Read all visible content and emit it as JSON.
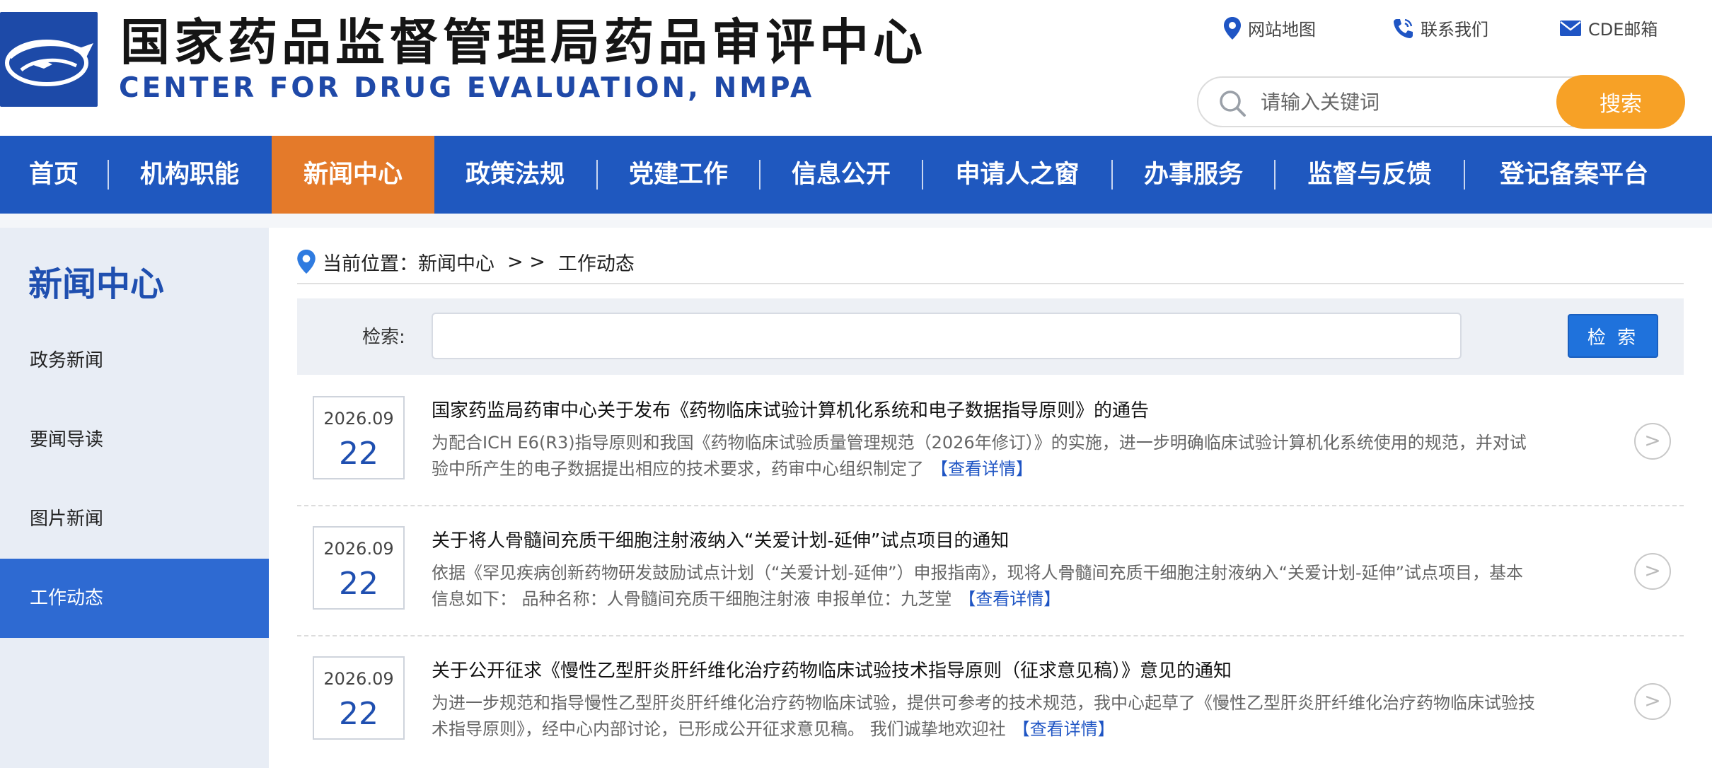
{
  "header": {
    "title_cn": "国家药品监督管理局药品审评中心",
    "title_en": "CENTER FOR DRUG EVALUATION, NMPA",
    "links": [
      {
        "label": "网站地图",
        "icon": "location-pin-icon"
      },
      {
        "label": "联系我们",
        "icon": "phone-icon"
      },
      {
        "label": "CDE邮箱",
        "icon": "mail-icon"
      }
    ],
    "search": {
      "placeholder": "请输入关键词",
      "button": "搜索"
    }
  },
  "nav": {
    "items": [
      {
        "label": "首页"
      },
      {
        "label": "机构职能"
      },
      {
        "label": "新闻中心",
        "active": true
      },
      {
        "label": "政策法规"
      },
      {
        "label": "党建工作"
      },
      {
        "label": "信息公开"
      },
      {
        "label": "申请人之窗"
      },
      {
        "label": "办事服务"
      },
      {
        "label": "监督与反馈"
      },
      {
        "label": "登记备案平台"
      }
    ]
  },
  "sidebar": {
    "title": "新闻中心",
    "items": [
      {
        "label": "政务新闻"
      },
      {
        "label": "要闻导读"
      },
      {
        "label": "图片新闻"
      },
      {
        "label": "工作动态",
        "active": true
      }
    ]
  },
  "breadcrumb": {
    "prefix": "当前位置：",
    "section": "新闻中心",
    "separator": "> >",
    "current": "工作动态"
  },
  "filter": {
    "label": "检索:",
    "value": "",
    "button": "检 索"
  },
  "news": [
    {
      "date_ym": "2026.09",
      "date_d": "22",
      "title": "国家药监局药审中心关于发布《药物临床试验计算机化系统和电子数据指导原则》的通告",
      "desc": "为配合ICH E6(R3)指导原则和我国《药物临床试验质量管理规范（2026年修订）》的实施，进一步明确临床试验计算机化系统使用的规范，并对试验中所产生的电子数据提出相应的技术要求，药审中心组织制定了",
      "more": "【查看详情】"
    },
    {
      "date_ym": "2026.09",
      "date_d": "22",
      "title": "关于将人骨髓间充质干细胞注射液纳入“关爱计划-延伸”试点项目的通知",
      "desc": "依据《罕见疾病创新药物研发鼓励试点计划（“关爱计划-延伸”）申报指南》，现将人骨髓间充质干细胞注射液纳入“关爱计划-延伸”试点项目，基本信息如下：  品种名称：人骨髓间充质干细胞注射液  申报单位：九芝堂",
      "more": "【查看详情】"
    },
    {
      "date_ym": "2026.09",
      "date_d": "22",
      "title": "关于公开征求《慢性乙型肝炎肝纤维化治疗药物临床试验技术指导原则（征求意见稿）》意见的通知",
      "desc": "为进一步规范和指导慢性乙型肝炎肝纤维化治疗药物临床试验，提供可参考的技术规范，我中心起草了《慢性乙型肝炎肝纤维化治疗药物临床试验技术指导原则》，经中心内部讨论，已形成公开征求意见稿。 我们诚挚地欢迎社",
      "more": "【查看详情】"
    }
  ],
  "colors": {
    "nav_bg": "#1f58bf",
    "nav_active": "#e47a2a",
    "search_button": "#f7a126",
    "brand_blue": "#1f4fb0",
    "sidebar_active": "#2e6ad2"
  }
}
